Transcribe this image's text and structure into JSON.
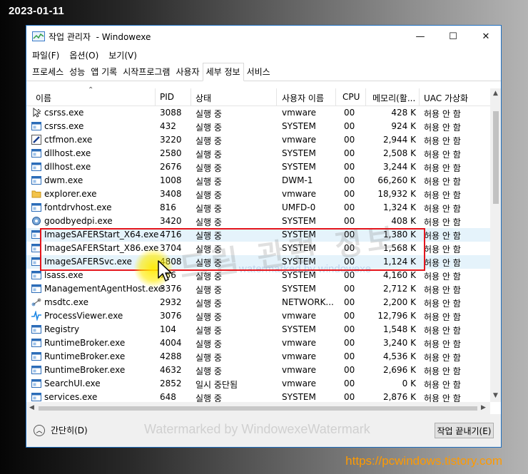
{
  "overlay": {
    "date": "2023-01-11",
    "url": "https://pcwindows.tistory.com",
    "watermark_bottom": "Watermarked by WindowexeWatermark",
    "watermark_blue": "watermarked by windowexe",
    "watermark_big": "드림 관련 정보"
  },
  "window": {
    "title": "작업 관리자  - Windowexe",
    "minimize": "—",
    "maximize": "☐",
    "close": "✕"
  },
  "menu": [
    "파일(F)",
    "옵션(O)",
    "보기(V)"
  ],
  "tabs": [
    {
      "label": "프로세스",
      "active": false
    },
    {
      "label": "성능",
      "active": false
    },
    {
      "label": "앱 기록",
      "active": false
    },
    {
      "label": "시작프로그램",
      "active": false
    },
    {
      "label": "사용자",
      "active": false
    },
    {
      "label": "세부 정보",
      "active": true
    },
    {
      "label": "서비스",
      "active": false
    }
  ],
  "columns": {
    "name": "이름",
    "pid": "PID",
    "status": "상태",
    "user": "사용자 이름",
    "cpu": "CPU",
    "memory": "메모리(활...",
    "uac": "UAC 가상화"
  },
  "rows": [
    {
      "icon": "cursor",
      "name": "csrss.exe",
      "pid": "3088",
      "status": "실행 중",
      "user": "vmware",
      "cpu": "00",
      "mem": "428 K",
      "uac": "허용 안 함",
      "hl": false
    },
    {
      "icon": "app",
      "name": "csrss.exe",
      "pid": "432",
      "status": "실행 중",
      "user": "SYSTEM",
      "cpu": "00",
      "mem": "924 K",
      "uac": "허용 안 함",
      "hl": false
    },
    {
      "icon": "pen",
      "name": "ctfmon.exe",
      "pid": "3220",
      "status": "실행 중",
      "user": "vmware",
      "cpu": "00",
      "mem": "2,944 K",
      "uac": "허용 안 함",
      "hl": false
    },
    {
      "icon": "app",
      "name": "dllhost.exe",
      "pid": "2580",
      "status": "실행 중",
      "user": "SYSTEM",
      "cpu": "00",
      "mem": "2,508 K",
      "uac": "허용 안 함",
      "hl": false
    },
    {
      "icon": "app",
      "name": "dllhost.exe",
      "pid": "2676",
      "status": "실행 중",
      "user": "SYSTEM",
      "cpu": "00",
      "mem": "3,244 K",
      "uac": "허용 안 함",
      "hl": false
    },
    {
      "icon": "app",
      "name": "dwm.exe",
      "pid": "1008",
      "status": "실행 중",
      "user": "DWM-1",
      "cpu": "00",
      "mem": "66,260 K",
      "uac": "허용 안 함",
      "hl": false
    },
    {
      "icon": "folder",
      "name": "explorer.exe",
      "pid": "3408",
      "status": "실행 중",
      "user": "vmware",
      "cpu": "00",
      "mem": "18,932 K",
      "uac": "허용 안 함",
      "hl": false
    },
    {
      "icon": "app",
      "name": "fontdrvhost.exe",
      "pid": "816",
      "status": "실행 중",
      "user": "UMFD-0",
      "cpu": "00",
      "mem": "1,324 K",
      "uac": "허용 안 함",
      "hl": false
    },
    {
      "icon": "gear",
      "name": "goodbyedpi.exe",
      "pid": "3420",
      "status": "실행 중",
      "user": "SYSTEM",
      "cpu": "00",
      "mem": "408 K",
      "uac": "허용 안 함",
      "hl": false
    },
    {
      "icon": "app",
      "name": "ImageSAFERStart_X64.exe",
      "pid": "4716",
      "status": "실행 중",
      "user": "SYSTEM",
      "cpu": "00",
      "mem": "1,380 K",
      "uac": "허용 안 함",
      "hl": true
    },
    {
      "icon": "app",
      "name": "ImageSAFERStart_X86.exe",
      "pid": "3704",
      "status": "실행 중",
      "user": "SYSTEM",
      "cpu": "00",
      "mem": "1,568 K",
      "uac": "허용 안 함",
      "hl": false
    },
    {
      "icon": "app",
      "name": "ImageSAFERSvc.exe",
      "pid": "4808",
      "status": "실행 중",
      "user": "SYSTEM",
      "cpu": "00",
      "mem": "1,124 K",
      "uac": "허용 안 함",
      "hl": true
    },
    {
      "icon": "app",
      "name": "lsass.exe",
      "pid": "756",
      "status": "실행 중",
      "user": "SYSTEM",
      "cpu": "00",
      "mem": "4,160 K",
      "uac": "허용 안 함",
      "hl": false
    },
    {
      "icon": "app",
      "name": "ManagementAgentHost.exe",
      "pid": "3376",
      "status": "실행 중",
      "user": "SYSTEM",
      "cpu": "00",
      "mem": "2,712 K",
      "uac": "허용 안 함",
      "hl": false
    },
    {
      "icon": "net",
      "name": "msdtc.exe",
      "pid": "2932",
      "status": "실행 중",
      "user": "NETWORK...",
      "cpu": "00",
      "mem": "2,200 K",
      "uac": "허용 안 함",
      "hl": false
    },
    {
      "icon": "pulse",
      "name": "ProcessViewer.exe",
      "pid": "3076",
      "status": "실행 중",
      "user": "vmware",
      "cpu": "00",
      "mem": "12,796 K",
      "uac": "허용 안 함",
      "hl": false
    },
    {
      "icon": "app",
      "name": "Registry",
      "pid": "104",
      "status": "실행 중",
      "user": "SYSTEM",
      "cpu": "00",
      "mem": "1,548 K",
      "uac": "허용 안 함",
      "hl": false
    },
    {
      "icon": "app",
      "name": "RuntimeBroker.exe",
      "pid": "4004",
      "status": "실행 중",
      "user": "vmware",
      "cpu": "00",
      "mem": "3,240 K",
      "uac": "허용 안 함",
      "hl": false
    },
    {
      "icon": "app",
      "name": "RuntimeBroker.exe",
      "pid": "4288",
      "status": "실행 중",
      "user": "vmware",
      "cpu": "00",
      "mem": "4,536 K",
      "uac": "허용 안 함",
      "hl": false
    },
    {
      "icon": "app",
      "name": "RuntimeBroker.exe",
      "pid": "4632",
      "status": "실행 중",
      "user": "vmware",
      "cpu": "00",
      "mem": "2,696 K",
      "uac": "허용 안 함",
      "hl": false
    },
    {
      "icon": "app",
      "name": "SearchUI.exe",
      "pid": "2852",
      "status": "일시 중단됨",
      "user": "vmware",
      "cpu": "00",
      "mem": "0 K",
      "uac": "허용 안 함",
      "hl": false
    },
    {
      "icon": "app",
      "name": "services.exe",
      "pid": "648",
      "status": "실행 중",
      "user": "SYSTEM",
      "cpu": "00",
      "mem": "2,876 K",
      "uac": "허용 안 함",
      "hl": false
    }
  ],
  "footer": {
    "fewer_details": "간단히(D)",
    "end_task": "작업 끝내기(E)"
  }
}
